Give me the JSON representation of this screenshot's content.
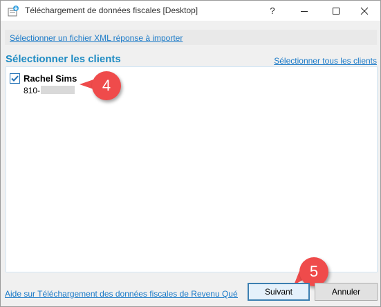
{
  "window": {
    "title": "Téléchargement de données fiscales [Desktop]",
    "help_glyph": "?",
    "controls": [
      "minimize",
      "maximize",
      "close"
    ]
  },
  "import": {
    "link_label": "Sélectionner un fichier XML réponse à importer"
  },
  "clients": {
    "section_title": "Sélectionner les clients",
    "select_all_label": "Sélectionner tous les clients",
    "items": [
      {
        "checked": true,
        "name": "Rachel Sims",
        "id_prefix": "810-"
      }
    ]
  },
  "callouts": [
    {
      "number": "4"
    },
    {
      "number": "5"
    }
  ],
  "footer": {
    "help_link": "Aide sur Téléchargement des données fiscales de Revenu Québ...",
    "next_label": "Suivant",
    "cancel_label": "Annuler"
  },
  "colors": {
    "accent": "#1e8bc3",
    "link": "#1a7ac8",
    "callout": "#ef4b4b"
  }
}
